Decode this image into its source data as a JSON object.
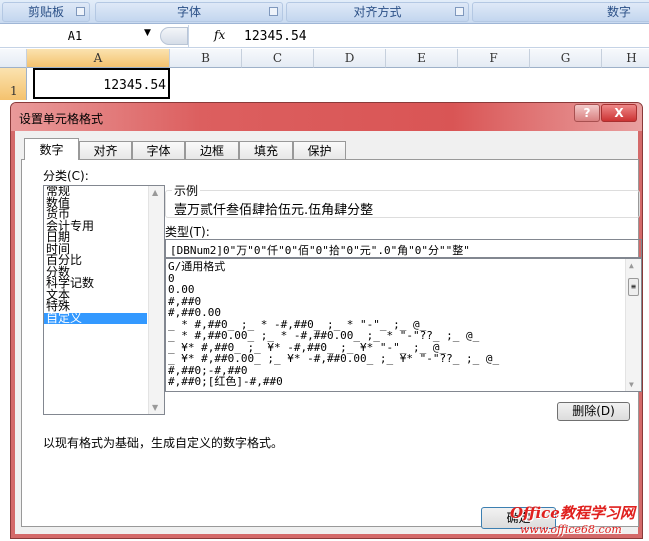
{
  "ribbon": {
    "groups": [
      "剪贴板",
      "字体",
      "对齐方式",
      "数字"
    ]
  },
  "formula_bar": {
    "name_box": "A1",
    "fx_label": "fx",
    "value": "12345.54"
  },
  "sheet": {
    "columns": [
      "A",
      "B",
      "C",
      "D",
      "E",
      "F",
      "G",
      "H"
    ],
    "rows": [
      "1"
    ],
    "cell_a1": "12345.54"
  },
  "dialog": {
    "title": "设置单元格格式",
    "help_label": "?",
    "close_label": "X",
    "tabs": [
      "数字",
      "对齐",
      "字体",
      "边框",
      "填充",
      "保护"
    ],
    "active_tab": "数字",
    "category_label": "分类(C):",
    "categories": [
      "常规",
      "数值",
      "货币",
      "会计专用",
      "日期",
      "时间",
      "百分比",
      "分数",
      "科学记数",
      "文本",
      "特殊",
      "自定义"
    ],
    "selected_category": "自定义",
    "sample_label": "示例",
    "sample_value": "壹万贰仟叁佰肆拾伍元.伍角肆分整",
    "type_label": "类型(T):",
    "type_value": "[DBNum2]0\"万\"0\"仟\"0\"佰\"0\"拾\"0\"元\".0\"角\"0\"分\"\"整\"",
    "formats": [
      "G/通用格式",
      "0",
      "0.00",
      "#,##0",
      "#,##0.00",
      "_ * #,##0_ ;_ * -#,##0_ ;_ * \"-\"_ ;_ @_",
      "_ * #,##0.00_ ;_ * -#,##0.00_ ;_ * \"-\"??_ ;_ @_",
      "_ ¥* #,##0_ ;_ ¥* -#,##0_ ;_ ¥* \"-\"_ ;_ @_",
      "_ ¥* #,##0.00_ ;_ ¥* -#,##0.00_ ;_ ¥* \"-\"??_ ;_ @_",
      "#,##0;-#,##0",
      "#,##0;[红色]-#,##0"
    ],
    "delete_label": "删除(D)",
    "description": "以现有格式为基础，生成自定义的数字格式。",
    "ok_label": "确定"
  },
  "watermark": {
    "line1": "Office教程学习网",
    "line2": "www.office68.com"
  },
  "colors": {
    "title_bar": "#dc5f5f",
    "selection": "#3399ff",
    "ribbon": "#c9daf0"
  }
}
